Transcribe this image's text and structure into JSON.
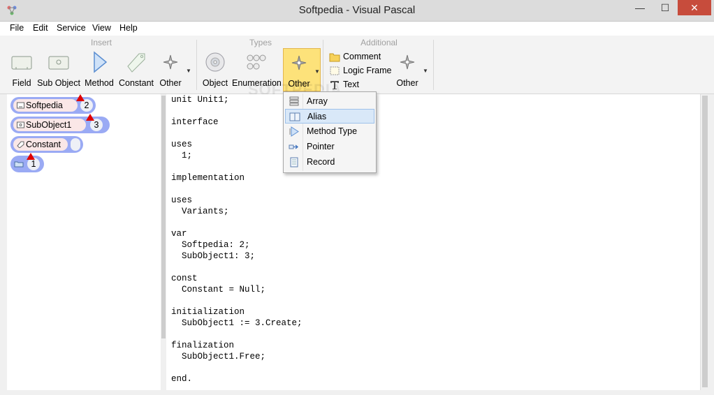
{
  "window": {
    "title": "Softpedia - Visual Pascal",
    "min_glyph": "—",
    "max_glyph": "☐",
    "close_glyph": "✕"
  },
  "menu": [
    "File",
    "Edit",
    "Service",
    "View",
    "Help"
  ],
  "ribbon": {
    "groups": [
      "Insert",
      "Types",
      "Additional"
    ],
    "insert": [
      "Field",
      "Sub Object",
      "Method",
      "Constant",
      "Other"
    ],
    "types": [
      "Object",
      "Enumeration",
      "Other"
    ],
    "additional_small": [
      "Comment",
      "Logic Frame",
      "Text"
    ],
    "additional_other": "Other"
  },
  "dropdown": {
    "items": [
      "Array",
      "Alias",
      "Method Type",
      "Pointer",
      "Record"
    ],
    "highlighted": "Alias"
  },
  "tree": [
    {
      "name": "Softpedia",
      "value": "2"
    },
    {
      "name": "SubObject1",
      "value": "3"
    },
    {
      "name": "Constant",
      "value": ""
    },
    {
      "name": "",
      "value": "1"
    }
  ],
  "code": "unit Unit1;\n\ninterface\n\nuses\n  1;\n\nimplementation\n\nuses\n  Variants;\n\nvar\n  Softpedia: 2;\n  SubObject1: 3;\n\nconst\n  Constant = Null;\n\ninitialization\n  SubObject1 := 3.Create;\n\nfinalization\n  SubObject1.Free;\n\nend.",
  "colors": {
    "node_outline": "#9aaaf4",
    "node_pill": "#fae7e7",
    "marker": "#e00000",
    "active_button": "#fde27a",
    "close_button": "#c74c3c"
  }
}
